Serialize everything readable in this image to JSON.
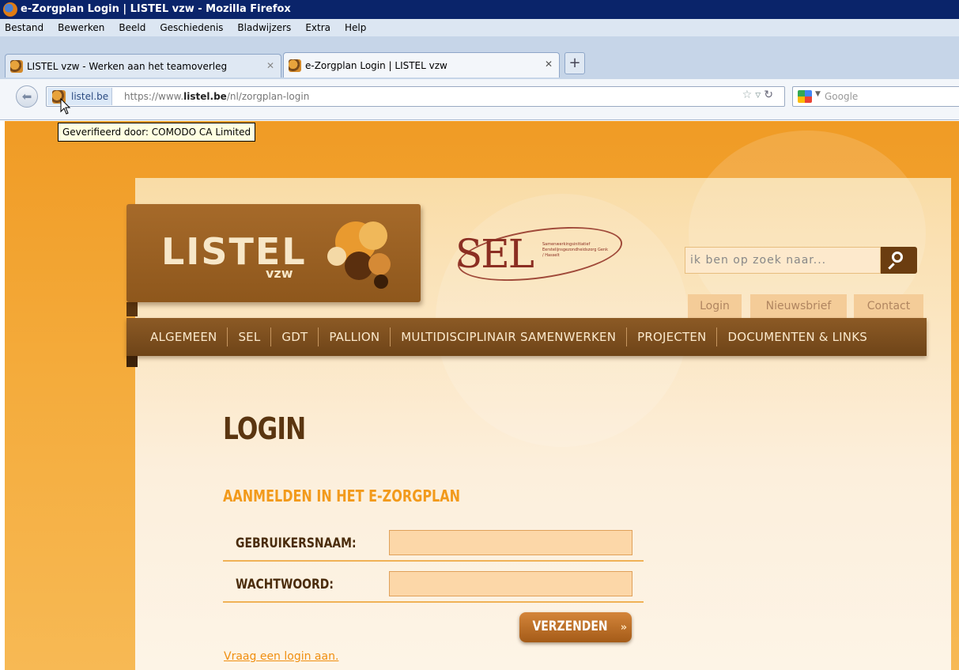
{
  "window": {
    "title": "e-Zorgplan Login | LISTEL vzw - Mozilla Firefox"
  },
  "menu": [
    "Bestand",
    "Bewerken",
    "Beeld",
    "Geschiedenis",
    "Bladwijzers",
    "Extra",
    "Help"
  ],
  "tabs": [
    {
      "label": "LISTEL vzw - Werken aan het teamoverleg",
      "active": false
    },
    {
      "label": "e-Zorgplan Login | LISTEL vzw",
      "active": true
    }
  ],
  "newtab": "+",
  "navbar": {
    "identity_label": "listel.be",
    "url_prefix": "https://www.",
    "url_domain": "listel.be",
    "url_path": "/nl/zorgplan-login",
    "search_engine": "Google",
    "tooltip": "Geverifieerd door: COMODO CA Limited"
  },
  "site": {
    "logo_text": "LISTEL",
    "logo_sub": "vzw",
    "sel_text": "SEL",
    "sel_tagline": "Samenwerkingsinitiatief Eerstelijnsgezondheidszorg Genk / Hasselt",
    "search_placeholder": "ik ben op zoek naar...",
    "toplinks": [
      "Login",
      "Nieuwsbrief",
      "Contact"
    ],
    "nav": [
      "ALGEMEEN",
      "SEL",
      "GDT",
      "PALLION",
      "MULTIDISCIPLINAIR SAMENWERKEN",
      "PROJECTEN",
      "DOCUMENTEN & LINKS"
    ]
  },
  "login": {
    "title": "LOGIN",
    "subtitle": "AANMELDEN IN HET E-ZORGPLAN",
    "username_label": "GEBRUIKERSNAAM:",
    "username_value": "",
    "password_label": "WACHTWOORD:",
    "password_value": "",
    "submit_label": "VERZENDEN",
    "submit_arrow": "»",
    "request_link": "Vraag een login aan."
  },
  "colors": {
    "brand_brown": "#6e4418",
    "brand_orange": "#f29a1b",
    "page_background": "#f4ab3b"
  }
}
